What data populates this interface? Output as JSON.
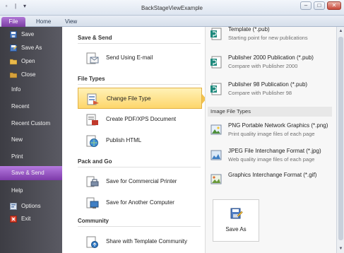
{
  "window": {
    "title": "BackStageViewExample",
    "controls": {
      "minimize": "–",
      "maximize": "□",
      "close": "✕"
    }
  },
  "quick_access": {
    "icon_a": "▫",
    "icon_b": "|",
    "dropdown": "▾"
  },
  "ribbon_tabs": [
    {
      "label": "File"
    },
    {
      "label": "Home"
    },
    {
      "label": "View"
    }
  ],
  "sidebar": {
    "items": [
      {
        "label": "Save",
        "icon": "save-icon"
      },
      {
        "label": "Save As",
        "icon": "save-as-icon"
      },
      {
        "label": "Open",
        "icon": "open-folder-icon"
      },
      {
        "label": "Close",
        "icon": "close-folder-icon"
      },
      {
        "label": "Info"
      },
      {
        "label": "Recent"
      },
      {
        "label": "Recent Custom"
      },
      {
        "label": "New"
      },
      {
        "label": "Print"
      },
      {
        "label": "Save & Send",
        "selected": true
      },
      {
        "label": "Help"
      },
      {
        "label": "Options",
        "icon": "options-icon"
      },
      {
        "label": "Exit",
        "icon": "exit-icon"
      }
    ]
  },
  "main": {
    "sections": [
      {
        "heading": "Save & Send",
        "commands": [
          {
            "label": "Send Using E-mail",
            "icon": "email-send-icon"
          }
        ]
      },
      {
        "heading": "File Types",
        "commands": [
          {
            "label": "Change File Type",
            "icon": "change-file-type-icon",
            "selected": true
          },
          {
            "label": "Create PDF/XPS Document",
            "icon": "pdf-document-icon"
          },
          {
            "label": "Publish HTML",
            "icon": "publish-html-icon"
          }
        ]
      },
      {
        "heading": "Pack and Go",
        "commands": [
          {
            "label": "Save for Commercial Printer",
            "icon": "commercial-printer-icon"
          },
          {
            "label": "Save for Another Computer",
            "icon": "another-computer-icon"
          }
        ]
      },
      {
        "heading": "Community",
        "commands": [
          {
            "label": "Share with Template Community",
            "icon": "template-community-icon"
          }
        ]
      }
    ]
  },
  "detail": {
    "publisher_files": [
      {
        "title": "Template (*.pub)",
        "description": "Starting point for new publications",
        "icon": "publisher-template-icon"
      },
      {
        "title": "Publisher 2000 Publication (*.pub)",
        "description": "Compare with Publisher 2000",
        "icon": "publisher-2000-icon"
      },
      {
        "title": "Publisher 98 Publication (*.pub)",
        "description": "Compare with Publisher 98",
        "icon": "publisher-98-icon"
      }
    ],
    "image_group_heading": "Image File Types",
    "image_files": [
      {
        "title": "PNG Portable Network Graphics (*.png)",
        "description": "Print quality image files of each page",
        "icon": "png-image-icon"
      },
      {
        "title": "JPEG File Interchange Format (*.jpg)",
        "description": "Web quality image files of each page",
        "icon": "jpeg-image-icon"
      },
      {
        "title": "Graphics Interchange Format (*.gif)",
        "description": "",
        "icon": "gif-image-icon"
      }
    ],
    "save_as_button": {
      "label": "Save As",
      "icon": "save-as-icon"
    }
  },
  "colors": {
    "file_tab": "#7c3ea3",
    "sidebar_bg": "#4a4a52",
    "sidebar_selected": "#8b44b7",
    "command_selected": "#fdd66b"
  }
}
